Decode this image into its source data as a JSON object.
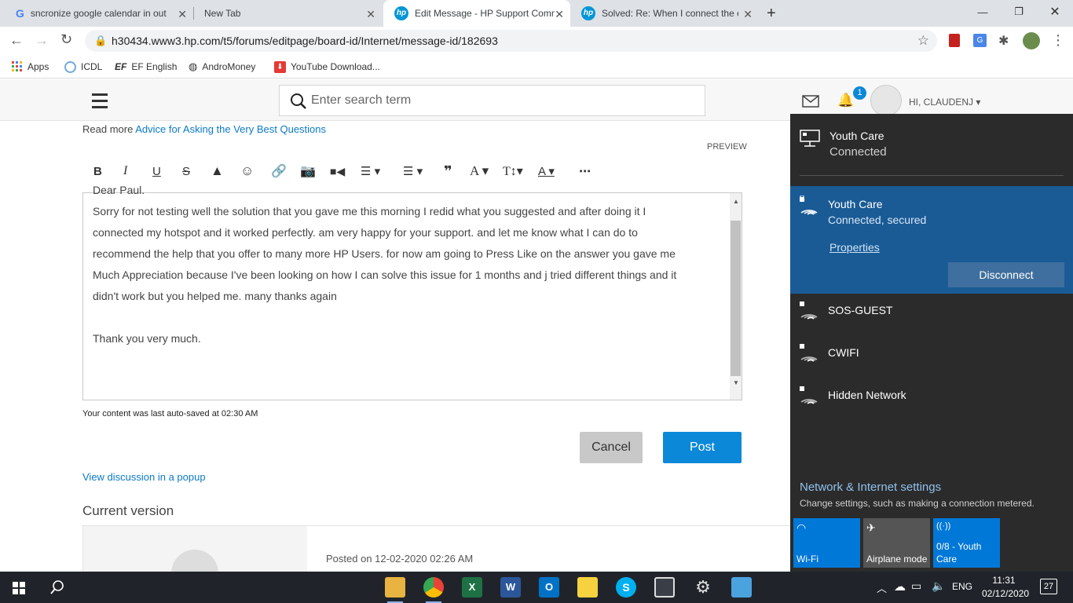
{
  "browser": {
    "tabs": [
      {
        "title": "sncronize google calendar in out",
        "active": false
      },
      {
        "title": "New Tab",
        "active": false
      },
      {
        "title": "Edit Message - HP Support Comm",
        "active": true
      },
      {
        "title": "Solved: Re: When I connect the e",
        "active": false
      }
    ],
    "url": "h30434.www3.hp.com/t5/forums/editpage/board-id/Internet/message-id/182693",
    "bookmarks": [
      "Apps",
      "ICDL",
      "EF English",
      "AndroMoney",
      "YouTube Download..."
    ]
  },
  "site_header": {
    "search_placeholder": "Enter search term",
    "notification_count": "1",
    "user_greeting": "HI, CLAUDENJ"
  },
  "editor": {
    "read_more_prefix": "Read more",
    "read_more_link": "Advice for Asking the Very Best Questions",
    "preview_label": "PREVIEW",
    "partial_first_line": "Dear Paul.",
    "lines": [
      "Sorry for not testing well the solution that you gave me this morning I redid what you suggested and after doing it I",
      "connected my hotspot and it worked perfectly. am very happy for your support. and let me know what I can do to",
      "recommend the help that you offer to many more HP Users. for now am going to Press Like on the answer you gave me",
      "Much Appreciation because I've been looking on how I can solve this issue for 1 months and j tried different things and it",
      "didn't work but you helped me. many thanks again"
    ],
    "closing": "Thank you very much.",
    "autosave": "Your content was last auto-saved at 02:30 AM",
    "cancel_label": "Cancel",
    "post_label": "Post",
    "popup_link": "View discussion in a popup",
    "current_version": "Current version",
    "posted_on": "Posted on 12-02-2020 02:26 AM"
  },
  "network": {
    "ethernet": {
      "name": "Youth Care",
      "status": "Connected"
    },
    "active_wifi": {
      "name": "Youth Care",
      "status": "Connected, secured",
      "properties_label": "Properties",
      "disconnect_label": "Disconnect"
    },
    "others": [
      "SOS-GUEST",
      "CWIFI",
      "Hidden Network"
    ],
    "settings_title": "Network & Internet settings",
    "settings_sub": "Change settings, such as making a connection metered.",
    "quick_actions": [
      "Wi-Fi",
      "Airplane mode",
      "0/8 - Youth Care"
    ]
  },
  "taskbar": {
    "language": "ENG",
    "time": "11:31",
    "date": "02/12/2020",
    "notifications": "27"
  },
  "colors": {
    "accent_blue": "#0b79c7",
    "flyout_bg": "#2b2b2b",
    "flyout_selected": "#1a5b96",
    "win_accent": "#0078d7"
  }
}
